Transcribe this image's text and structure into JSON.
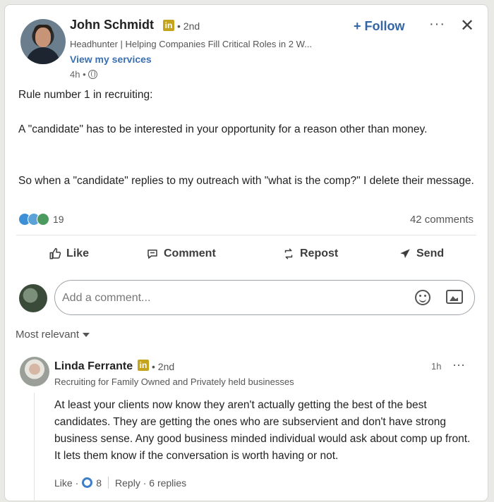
{
  "post": {
    "author_name": "John Schmidt",
    "degree": "• 2nd",
    "headline": "Headhunter | Helping Companies Fill Critical Roles in 2 W...",
    "services_link": "View my services",
    "time": "4h •",
    "follow_label": "+ Follow",
    "more_label": "···",
    "close_label": "✕",
    "linkedin_badge": "in",
    "text_1": "Rule number 1 in recruiting:",
    "text_2": "A \"candidate\" has to be interested in your opportunity for a reason other than money.",
    "text_3": "So when a \"candidate\" replies to my outreach with \"what is the comp?\" I delete their message.",
    "reaction_count": "19",
    "comments_count": "42 comments"
  },
  "actions": {
    "like": "Like",
    "comment": "Comment",
    "repost": "Repost",
    "send": "Send"
  },
  "composer": {
    "placeholder": "Add a comment..."
  },
  "sort": {
    "label": "Most relevant"
  },
  "comment": {
    "author_name": "Linda Ferrante",
    "linkedin_badge": "in",
    "degree": "• 2nd",
    "headline": "Recruiting for Family Owned and Privately held businesses",
    "time": "1h",
    "more_label": "···",
    "text": "At least your clients now know they aren't actually getting the best of the best candidates. They are getting the ones who are subservient and don't have strong business sense. Any good business minded individual would ask about comp up front. It lets them know if the conversation is worth having or not.",
    "like_label": "Like ·",
    "like_count": "8",
    "reply_label": "Reply · 6 replies"
  },
  "colors": {
    "accent": "#3465a4",
    "linkedin_badge": "#c4a31d",
    "like_blue": "#3d7fc7"
  }
}
